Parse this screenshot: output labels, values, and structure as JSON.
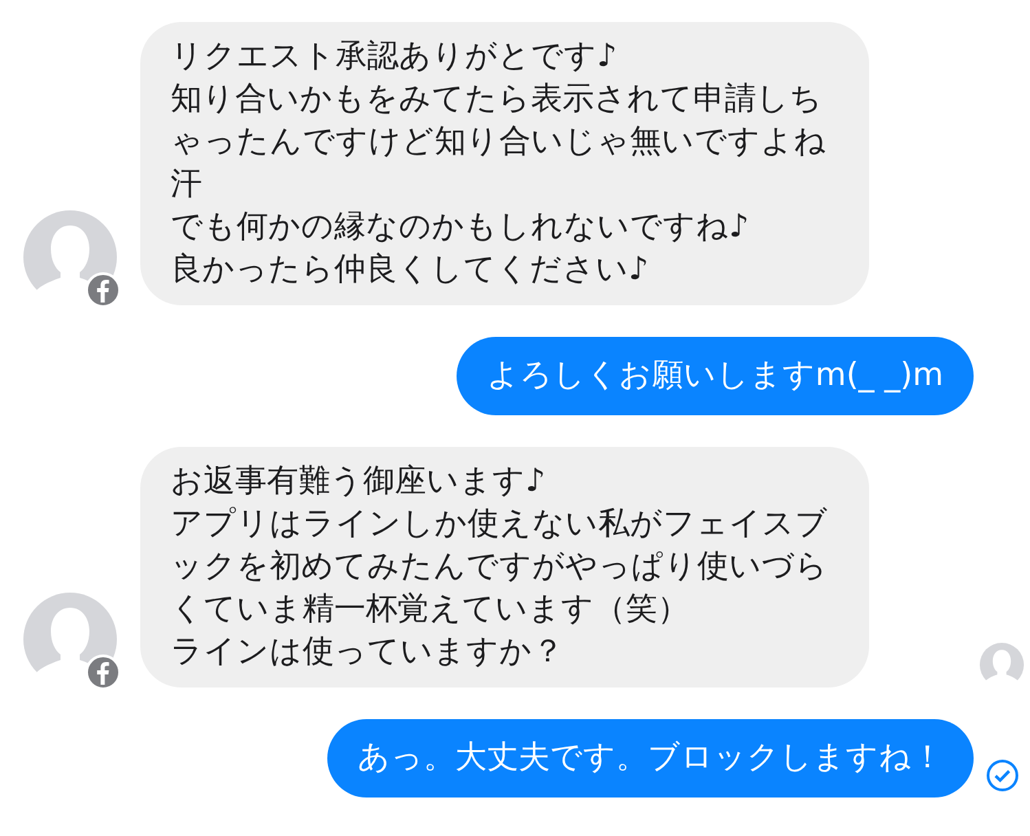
{
  "messages": [
    {
      "kind": "incoming",
      "paragraphs": [
        "リクエスト承認ありがとです♪",
        "知り合いかもをみてたら表示されて申請しちゃったんですけど知り合いじゃ無いですよね汗",
        "でも何かの縁なのかもしれないですね♪",
        "良かったら仲良くしてください♪"
      ],
      "seen": false,
      "delivered": false
    },
    {
      "kind": "outgoing",
      "paragraphs": [
        "よろしくお願いしますm(_ _)m"
      ],
      "seen": false,
      "delivered": false
    },
    {
      "kind": "incoming",
      "paragraphs": [
        "お返事有難う御座います♪",
        "アプリはラインしか使えない私がフェイスブックを初めてみたんですがやっぱり使いづらくていま精一杯覚えています（笑）",
        "ラインは使っていますか？"
      ],
      "seen": true,
      "delivered": false
    },
    {
      "kind": "outgoing",
      "paragraphs": [
        "あっ。大丈夫です。ブロックしますね！"
      ],
      "seen": false,
      "delivered": true
    }
  ]
}
